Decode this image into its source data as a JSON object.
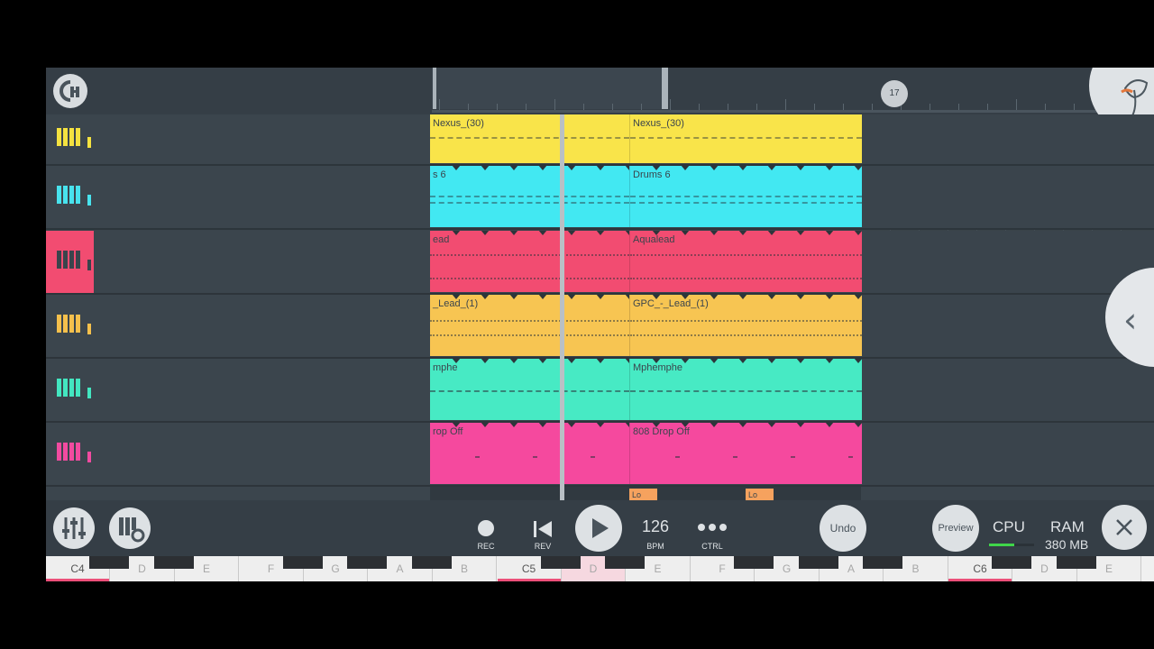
{
  "ruler": {
    "bar_marker": "17"
  },
  "tracks": [
    {
      "id": "t1",
      "color": "#f9e44a",
      "icon_color": "#f4e240",
      "clip_left": "Nexus_(30)",
      "clip_right": "Nexus_(30)",
      "selected": false
    },
    {
      "id": "t2",
      "color": "#42e8f2",
      "icon_color": "#48e3ee",
      "clip_left": "s 6",
      "clip_right": "Drums 6",
      "selected": false
    },
    {
      "id": "t3",
      "color": "#f24c71",
      "icon_color": "#f04a72",
      "clip_left": "ead",
      "clip_right": "Aqualead",
      "selected": true
    },
    {
      "id": "t4",
      "color": "#f7c552",
      "icon_color": "#f5c04c",
      "clip_left": "_Lead_(1)",
      "clip_right": "GPC_-_Lead_(1)",
      "selected": false
    },
    {
      "id": "t5",
      "color": "#47eac4",
      "icon_color": "#43e6c0",
      "clip_left": "mphe",
      "clip_right": "Mphemphe",
      "selected": false
    },
    {
      "id": "t6",
      "color": "#f5499e",
      "icon_color": "#f24ba0",
      "clip_left": "rop Off",
      "clip_right": "808 Drop Off",
      "selected": false
    }
  ],
  "partial_row": {
    "color": "#f6a25e",
    "clip_a": "Lo",
    "clip_b": "Lo"
  },
  "transport": {
    "rec_label": "REC",
    "rev_label": "REV",
    "tempo_value": "126",
    "tempo_label": "BPM",
    "ctrl_label": "CTRL",
    "undo_label": "Undo",
    "preview_label": "Preview",
    "cpu_label": "CPU",
    "cpu_level": 0.55,
    "ram_label": "RAM",
    "ram_value": "380 MB"
  },
  "keyboard": {
    "keys": [
      "C4",
      "D",
      "E",
      "F",
      "G",
      "A",
      "B",
      "C5",
      "D",
      "E",
      "F",
      "G",
      "A",
      "B",
      "C6",
      "D",
      "E"
    ]
  },
  "colors": {
    "accent": "#ec4f79",
    "background": "#3a444c"
  }
}
